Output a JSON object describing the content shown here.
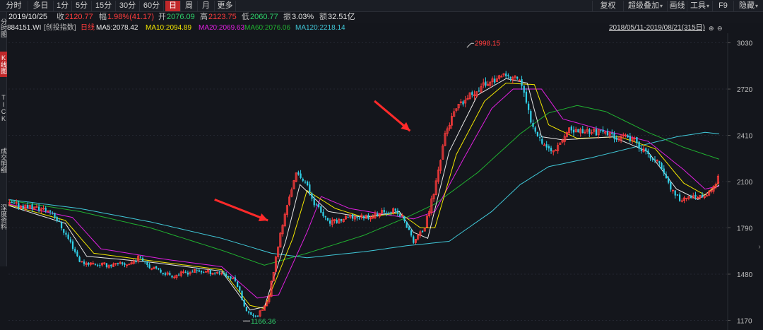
{
  "toolbar": {
    "tabs": [
      "分时",
      "多日",
      "1分",
      "5分",
      "15分",
      "30分",
      "60分",
      "日",
      "周",
      "月",
      "更多"
    ],
    "active_tab": "日",
    "tools": [
      "复权",
      "超级叠加",
      "画线",
      "工具",
      "F9",
      "隐藏"
    ]
  },
  "quote": {
    "date": "2019/10/25",
    "close_label": "收",
    "close": "2120.77",
    "change_label": "幅",
    "change": "1.98%(41.17)",
    "open_label": "开",
    "open": "2076.09",
    "high_label": "高",
    "high": "2123.75",
    "low_label": "低",
    "low": "2060.77",
    "amplitude_label": "振",
    "amplitude": "3.03%",
    "amount_label": "额",
    "amount": "32.51亿"
  },
  "indicator": {
    "code": "884151.WI",
    "name": "[创投指数]",
    "period": "日线",
    "ma5": "MA5:2078.42",
    "ma10": "MA10:2094.89",
    "ma20": "MA20:2069.63",
    "ma60": "MA60:2076.06",
    "ma120": "MA120:2218.14",
    "range": "2018/05/11-2019/08/21(315日)"
  },
  "left_tabs": [
    "分时图",
    "K线图",
    "TICK",
    "成交明细",
    "深度资料"
  ],
  "colors": {
    "ma5": "#e8e8e8",
    "ma10": "#f2e600",
    "ma20": "#e020e0",
    "ma60": "#20b030",
    "ma120": "#40c8d8",
    "up": "#ff3c3c",
    "down": "#30d0e8",
    "arrow": "#ff2a2a",
    "accent": "#c0282a"
  },
  "chart_data": {
    "type": "candlestick",
    "y_ticks": [
      3030,
      2720,
      2410,
      2100,
      1790,
      1480,
      1170
    ],
    "ylim": [
      1120,
      3080
    ],
    "grid": true,
    "annotations": [
      {
        "label": "2998.15",
        "value": 2998.15,
        "kind": "high",
        "date_index": 0.645
      },
      {
        "label": "1166.36",
        "value": 1166.36,
        "kind": "low",
        "date_index": 0.33
      }
    ],
    "series_points": 315,
    "ohlc_keypoints": [
      [
        0.0,
        1950
      ],
      [
        0.03,
        1930
      ],
      [
        0.06,
        1900
      ],
      [
        0.085,
        1700
      ],
      [
        0.1,
        1560
      ],
      [
        0.14,
        1540
      ],
      [
        0.17,
        1550
      ],
      [
        0.185,
        1600
      ],
      [
        0.2,
        1520
      ],
      [
        0.23,
        1470
      ],
      [
        0.26,
        1500
      ],
      [
        0.3,
        1490
      ],
      [
        0.32,
        1430
      ],
      [
        0.335,
        1220
      ],
      [
        0.35,
        1200
      ],
      [
        0.365,
        1300
      ],
      [
        0.38,
        1700
      ],
      [
        0.395,
        2010
      ],
      [
        0.405,
        2150
      ],
      [
        0.415,
        2120
      ],
      [
        0.43,
        1960
      ],
      [
        0.45,
        1820
      ],
      [
        0.48,
        1860
      ],
      [
        0.51,
        1870
      ],
      [
        0.54,
        1910
      ],
      [
        0.555,
        1860
      ],
      [
        0.57,
        1700
      ],
      [
        0.585,
        1780
      ],
      [
        0.6,
        2050
      ],
      [
        0.615,
        2430
      ],
      [
        0.63,
        2580
      ],
      [
        0.645,
        2650
      ],
      [
        0.66,
        2720
      ],
      [
        0.68,
        2780
      ],
      [
        0.7,
        2800
      ],
      [
        0.72,
        2790
      ],
      [
        0.735,
        2520
      ],
      [
        0.75,
        2380
      ],
      [
        0.765,
        2300
      ],
      [
        0.79,
        2440
      ],
      [
        0.82,
        2440
      ],
      [
        0.85,
        2410
      ],
      [
        0.88,
        2380
      ],
      [
        0.9,
        2280
      ],
      [
        0.92,
        2200
      ],
      [
        0.94,
        1990
      ],
      [
        0.96,
        1990
      ],
      [
        0.975,
        1990
      ],
      [
        0.99,
        2030
      ],
      [
        1.0,
        2120
      ]
    ],
    "ma_keypoints": {
      "ma5": [
        [
          0.0,
          1940
        ],
        [
          0.08,
          1820
        ],
        [
          0.11,
          1600
        ],
        [
          0.2,
          1560
        ],
        [
          0.3,
          1500
        ],
        [
          0.34,
          1240
        ],
        [
          0.36,
          1260
        ],
        [
          0.39,
          1700
        ],
        [
          0.41,
          2080
        ],
        [
          0.45,
          1900
        ],
        [
          0.5,
          1860
        ],
        [
          0.55,
          1900
        ],
        [
          0.57,
          1760
        ],
        [
          0.59,
          1720
        ],
        [
          0.62,
          2300
        ],
        [
          0.66,
          2680
        ],
        [
          0.7,
          2790
        ],
        [
          0.73,
          2760
        ],
        [
          0.75,
          2400
        ],
        [
          0.78,
          2380
        ],
        [
          0.85,
          2400
        ],
        [
          0.9,
          2300
        ],
        [
          0.94,
          2050
        ],
        [
          0.97,
          1980
        ],
        [
          1.0,
          2078
        ]
      ],
      "ma10": [
        [
          0.0,
          1945
        ],
        [
          0.08,
          1840
        ],
        [
          0.12,
          1620
        ],
        [
          0.2,
          1570
        ],
        [
          0.3,
          1510
        ],
        [
          0.34,
          1270
        ],
        [
          0.36,
          1250
        ],
        [
          0.4,
          1720
        ],
        [
          0.42,
          2040
        ],
        [
          0.46,
          1920
        ],
        [
          0.5,
          1860
        ],
        [
          0.55,
          1890
        ],
        [
          0.58,
          1790
        ],
        [
          0.6,
          1790
        ],
        [
          0.63,
          2280
        ],
        [
          0.67,
          2640
        ],
        [
          0.7,
          2760
        ],
        [
          0.74,
          2750
        ],
        [
          0.76,
          2480
        ],
        [
          0.8,
          2390
        ],
        [
          0.86,
          2400
        ],
        [
          0.91,
          2320
        ],
        [
          0.95,
          2090
        ],
        [
          0.98,
          2010
        ],
        [
          1.0,
          2095
        ]
      ],
      "ma20": [
        [
          0.0,
          1950
        ],
        [
          0.09,
          1860
        ],
        [
          0.13,
          1650
        ],
        [
          0.22,
          1580
        ],
        [
          0.3,
          1530
        ],
        [
          0.35,
          1320
        ],
        [
          0.38,
          1340
        ],
        [
          0.42,
          1760
        ],
        [
          0.44,
          2000
        ],
        [
          0.48,
          1920
        ],
        [
          0.53,
          1880
        ],
        [
          0.57,
          1850
        ],
        [
          0.6,
          1900
        ],
        [
          0.64,
          2250
        ],
        [
          0.68,
          2590
        ],
        [
          0.71,
          2720
        ],
        [
          0.75,
          2720
        ],
        [
          0.78,
          2520
        ],
        [
          0.84,
          2440
        ],
        [
          0.9,
          2370
        ],
        [
          0.95,
          2180
        ],
        [
          0.98,
          2050
        ],
        [
          1.0,
          2070
        ]
      ],
      "ma60": [
        [
          0.0,
          1975
        ],
        [
          0.1,
          1900
        ],
        [
          0.2,
          1790
        ],
        [
          0.3,
          1640
        ],
        [
          0.36,
          1540
        ],
        [
          0.42,
          1620
        ],
        [
          0.5,
          1740
        ],
        [
          0.56,
          1860
        ],
        [
          0.6,
          1950
        ],
        [
          0.66,
          2160
        ],
        [
          0.72,
          2420
        ],
        [
          0.76,
          2560
        ],
        [
          0.8,
          2610
        ],
        [
          0.84,
          2570
        ],
        [
          0.9,
          2430
        ],
        [
          0.95,
          2330
        ],
        [
          1.0,
          2250
        ]
      ],
      "ma120": [
        [
          0.0,
          1980
        ],
        [
          0.1,
          1920
        ],
        [
          0.2,
          1830
        ],
        [
          0.3,
          1720
        ],
        [
          0.37,
          1620
        ],
        [
          0.42,
          1590
        ],
        [
          0.5,
          1630
        ],
        [
          0.56,
          1670
        ],
        [
          0.62,
          1700
        ],
        [
          0.68,
          1900
        ],
        [
          0.72,
          2080
        ],
        [
          0.76,
          2200
        ],
        [
          0.82,
          2260
        ],
        [
          0.88,
          2330
        ],
        [
          0.94,
          2400
        ],
        [
          0.98,
          2430
        ],
        [
          1.0,
          2420
        ]
      ]
    },
    "arrows": [
      {
        "from": [
          0.29,
          1980
        ],
        "to": [
          0.365,
          1840
        ]
      },
      {
        "from": [
          0.515,
          2640
        ],
        "to": [
          0.565,
          2440
        ]
      }
    ]
  }
}
